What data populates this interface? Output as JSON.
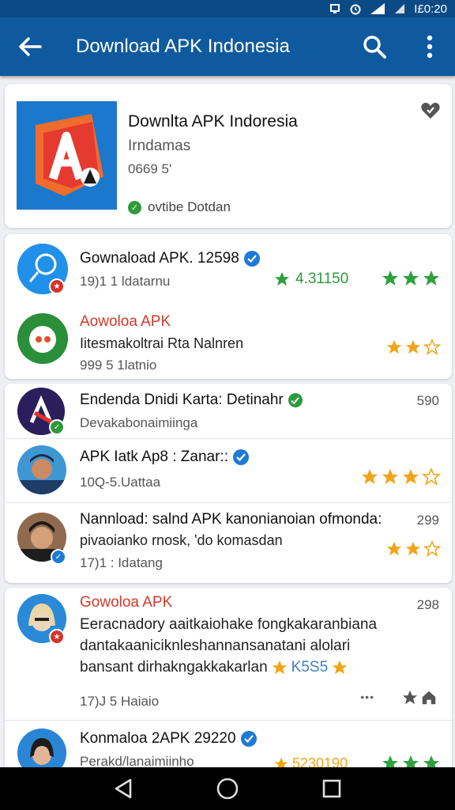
{
  "status_bar": {
    "time": "I£0:20"
  },
  "app_bar": {
    "title": "Download APK Indonesia"
  },
  "featured": {
    "name": "Downlta APK Indoresia",
    "subtitle": "Irndamas",
    "size": "0669 5'",
    "status": "ovtibe Dotdan"
  },
  "list_group_1": [
    {
      "title": "Gownaload APK. 12598",
      "meta": "19)1 1 ldatarnu",
      "rating": "4.31150",
      "stars": 3
    },
    {
      "title": "Aowoloa APK",
      "desc": "Iitesmakoltrai Rta  Nalnren",
      "meta": "999 5 1latnio",
      "stars": 2
    }
  ],
  "list_group_2": [
    {
      "title": "Endenda Dnidi Karta: Detinahr",
      "desc": "Devakabonaimiinga",
      "count": "590"
    },
    {
      "title": "APK Iatk Ap8 :  Zanar::",
      "meta": "10Q-5.Uattaa",
      "stars": 3
    },
    {
      "title": "Nannload: salnd APK kanonianoian ofmonda:",
      "desc": "pivaoianko rnosk, 'do komasdan",
      "meta": "17)1 : Idatang",
      "count": "299",
      "stars": 2
    }
  ],
  "list_group_3": [
    {
      "title": "Gowoloa APK",
      "desc1": "Eeracnadory aaitkaiohake fongkakaranbiana",
      "desc2": "dantakaaniciknleshannansanatani alolari",
      "desc3": "bansant dirhakngakkakarlan",
      "inline_rating": "K5S5",
      "meta": "17)J 5 Haiaio",
      "count": "298",
      "dots": "•••"
    },
    {
      "title": "Konmaloa 2APK 29220",
      "desc": "Perakd/lanaimiinho",
      "rating": "5230190"
    }
  ]
}
